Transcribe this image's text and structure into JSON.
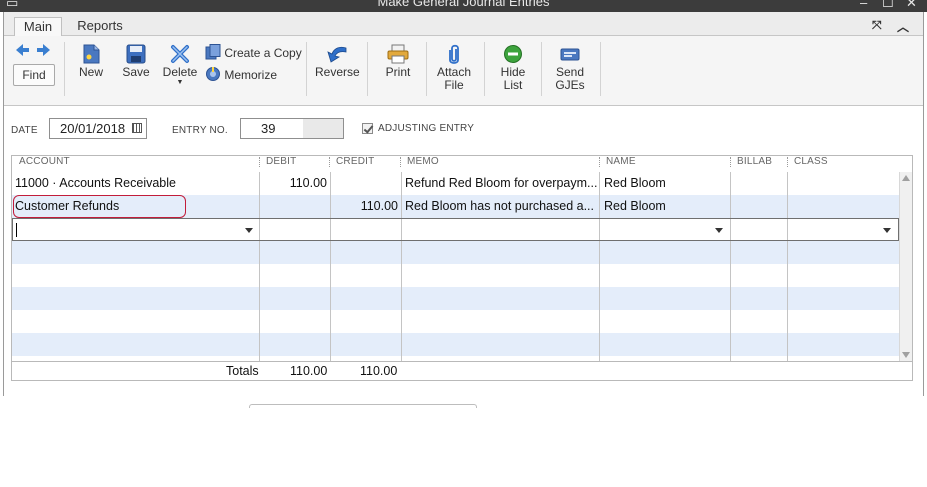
{
  "window": {
    "title": "Make General Journal Entries"
  },
  "tabs": [
    {
      "label": "Main"
    },
    {
      "label": "Reports"
    }
  ],
  "toolbar": {
    "find": "Find",
    "new": "New",
    "save": "Save",
    "delete": "Delete",
    "create_copy": "Create a Copy",
    "memorize": "Memorize",
    "reverse": "Reverse",
    "print": "Print",
    "attach_1": "Attach",
    "attach_2": "File",
    "hide_1": "Hide",
    "hide_2": "List",
    "send_1": "Send",
    "send_2": "GJEs"
  },
  "form": {
    "date_label": "DATE",
    "date_value": "20/01/2018",
    "entry_label": "ENTRY NO.",
    "entry_value": "39",
    "adjusting_label": "ADJUSTING ENTRY",
    "adjusting_checked": true
  },
  "grid": {
    "headers": {
      "account": "ACCOUNT",
      "debit": "DEBIT",
      "credit": "CREDIT",
      "memo": "MEMO",
      "name": "NAME",
      "billable": "BILLAB",
      "class": "CLASS"
    },
    "rows": [
      {
        "account": "11000 · Accounts Receivable",
        "debit": "110.00",
        "credit": "",
        "memo": "Refund Red Bloom for overpaym...",
        "name": "Red Bloom"
      },
      {
        "account": "Customer Refunds",
        "debit": "",
        "credit": "110.00",
        "memo": "Red Bloom has not purchased a...",
        "name": "Red Bloom"
      }
    ],
    "totals_label": "Totals",
    "total_debit": "110.00",
    "total_credit": "110.00"
  },
  "colors": {
    "highlight_ring": "#c21d3a",
    "row_alt": "#e4edfa"
  }
}
